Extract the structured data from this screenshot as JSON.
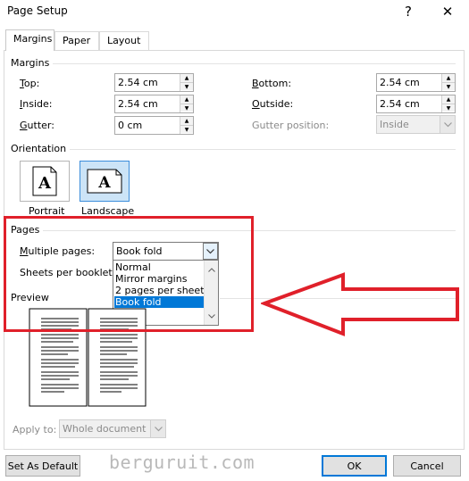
{
  "window": {
    "title": "Page Setup",
    "help_label": "?",
    "close_label": "✕"
  },
  "tabs": [
    {
      "label": "Margins"
    },
    {
      "label": "Paper"
    },
    {
      "label": "Layout"
    }
  ],
  "margins": {
    "group_label": "Margins",
    "top": {
      "label": "Top:",
      "value": "2.54 cm"
    },
    "bottom": {
      "label": "Bottom:",
      "value": "2.54 cm"
    },
    "inside": {
      "label": "Inside:",
      "value": "2.54 cm"
    },
    "outside": {
      "label": "Outside:",
      "value": "2.54 cm"
    },
    "gutter": {
      "label": "Gutter:",
      "value": "0 cm"
    },
    "gutter_position": {
      "label": "Gutter position:",
      "value": "Inside"
    }
  },
  "orientation": {
    "group_label": "Orientation",
    "portrait": {
      "label": "Portrait",
      "glyph": "A"
    },
    "landscape": {
      "label": "Landscape",
      "glyph": "A"
    }
  },
  "pages": {
    "group_label": "Pages",
    "multiple_pages_label": "Multiple pages:",
    "multiple_pages_value": "Book fold",
    "sheets_per_booklet_label": "Sheets per booklet:",
    "options": [
      "Normal",
      "Mirror margins",
      "2 pages per sheet",
      "Book fold"
    ],
    "selected_option": "Book fold"
  },
  "preview": {
    "group_label": "Preview"
  },
  "apply_to": {
    "label": "Apply to:",
    "value": "Whole document"
  },
  "buttons": {
    "set_default": "Set As Default",
    "ok": "OK",
    "cancel": "Cancel"
  },
  "watermark": "berguruit.com",
  "annotation_color": "#e0202a",
  "accent_color": "#0078d7"
}
